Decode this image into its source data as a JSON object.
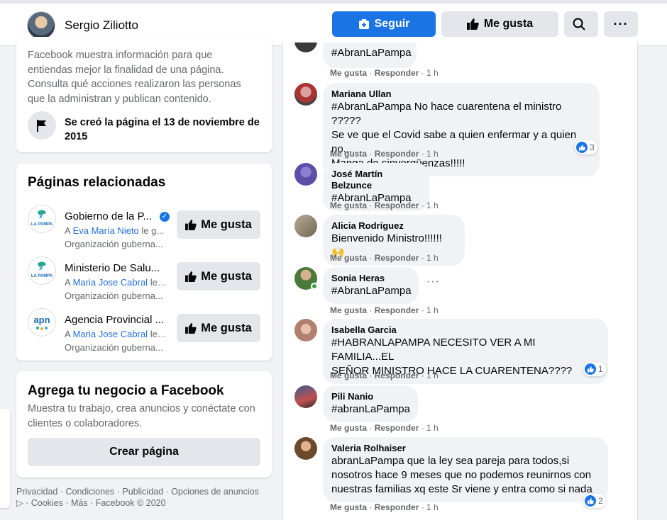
{
  "header": {
    "profile_name": "Sergio Ziliotto",
    "follow_label": "Seguir",
    "like_label": "Me gusta",
    "more_label": "···"
  },
  "info": {
    "text": "Facebook muestra información para que entiendas mejor la finalidad de una página. Consulta qué acciones realizaron las personas que la administran y publican contenido.",
    "created": "Se creó la página el 13 de noviembre de 2015"
  },
  "related": {
    "title": "Páginas relacionadas",
    "button_label": "Me gusta",
    "items": [
      {
        "name": "Gobierno de la P...",
        "prefix": "A ",
        "friend": "Eva María Nieto",
        "suffix": " le g...",
        "category": "Organización guberna...",
        "verified": true,
        "logo_text": "LA PAMPA"
      },
      {
        "name": "Ministerio De Salu...",
        "prefix": "A ",
        "friend": "Maria Jose Cabral",
        "suffix": " le ...",
        "category": "Organización guberna...",
        "verified": false,
        "logo_text": "LA PAMPA"
      },
      {
        "name": "Agencia Provincial ...",
        "prefix": "A ",
        "friend": "Maria Jose Cabral",
        "suffix": " le ...",
        "category": "Organización guberna...",
        "verified": false,
        "logo_text": "apn"
      }
    ]
  },
  "business": {
    "title": "Agrega tu negocio a Facebook",
    "description": "Muestra tu trabajo, crea anuncios y conéctate con clientes o colaboradores.",
    "button_label": "Crear página"
  },
  "footer": {
    "line1": "Privacidad · Condiciones · Publicidad · Opciones de anuncios",
    "line2": " · Cookies · Más · Facebook © 2020"
  },
  "comments": {
    "like_label": "Me gusta",
    "reply_label": "Responder",
    "time": "1 h",
    "items": [
      {
        "author": "",
        "lines": [
          "#AbranLaPampa"
        ],
        "reactions": null
      },
      {
        "author": "Mariana Ullan",
        "lines": [
          "#AbranLaPampa No hace cuarentena el ministro ?????",
          "Se ve que el Covid sabe a quien enfermar y a quien no...",
          "Manga de sinvergüenzas!!!!!"
        ],
        "reactions": "3"
      },
      {
        "author": "José Martín Belzunce",
        "lines": [
          "#AbranLaPampa"
        ],
        "reactions": null
      },
      {
        "author": "Alicia Rodríguez",
        "lines": [
          "Bienvenido Ministro!!!!!! 🙌"
        ],
        "reactions": null
      },
      {
        "author": "Sonia Heras",
        "lines": [
          "#AbranLaPampa"
        ],
        "reactions": null
      },
      {
        "author": "Isabella Garcia",
        "lines": [
          "#HABRANLAPAMPA NECESITO VER A MI FAMILIA...EL",
          "SEÑOR MINISTRO HACE LA CUARENTENA????"
        ],
        "reactions": "1"
      },
      {
        "author": "Pili Nanio",
        "lines": [
          "#abranLaPampa"
        ],
        "reactions": null
      },
      {
        "author": "Valeria Rolhaiser",
        "lines": [
          "abranLaPampa que la ley sea pareja para todos,si",
          "nosotros hace 9 meses que no podemos reunirnos con",
          "nuestras familias xq este Sr viene y entra como si nada"
        ],
        "reactions": "2"
      }
    ]
  }
}
